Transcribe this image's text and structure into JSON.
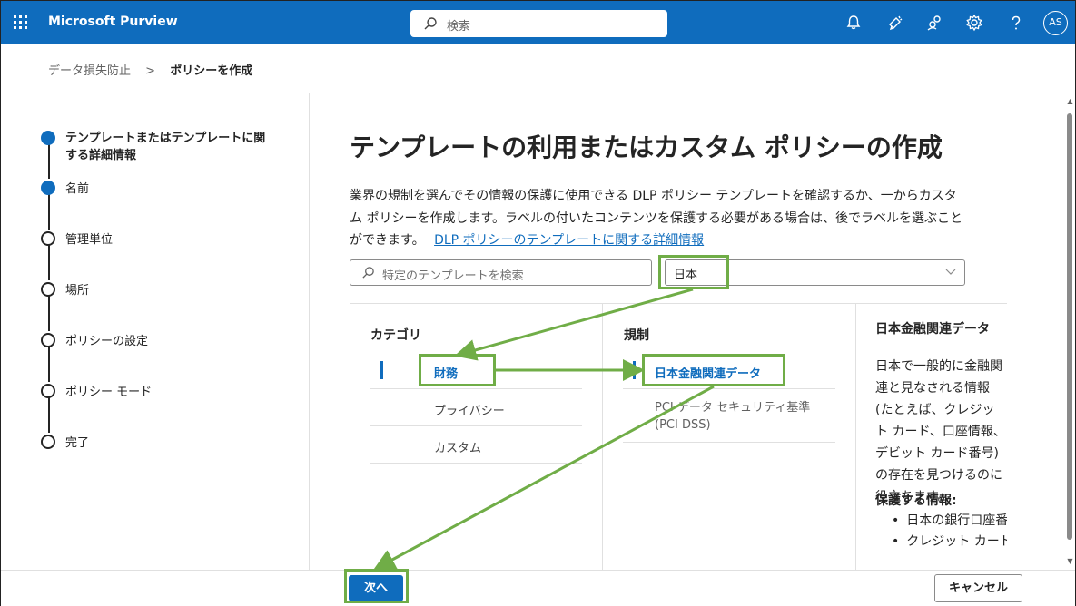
{
  "header": {
    "brand": "Microsoft Purview",
    "search_placeholder": "検索",
    "avatar_initials": "AS",
    "color": "#0f6cbd"
  },
  "breadcrumb": {
    "parent": "データ損失防止",
    "current": "ポリシーを作成"
  },
  "steps": [
    {
      "label": "テンプレートまたはテンプレートに関する詳細情報",
      "state": "done"
    },
    {
      "label": "名前",
      "state": "done"
    },
    {
      "label": "管理単位",
      "state": "todo"
    },
    {
      "label": "場所",
      "state": "todo"
    },
    {
      "label": "ポリシーの設定",
      "state": "todo"
    },
    {
      "label": "ポリシー モード",
      "state": "todo"
    },
    {
      "label": "完了",
      "state": "todo"
    }
  ],
  "main": {
    "title": "テンプレートの利用またはカスタム ポリシーの作成",
    "description_line1": "業界の規制を選んでその情報の保護に使用できる DLP ポリシー テンプレートを確認するか、一からカスタ",
    "description_line2": "ム ポリシーを作成します。ラベルの付いたコンテンツを保護する必要がある場合は、後でラベルを選ぶこと",
    "description_line3": "ができます。",
    "link": "DLP ポリシーのテンプレートに関する詳細情報",
    "template_search_placeholder": "特定のテンプレートを検索",
    "region_value": "日本"
  },
  "categories": {
    "header": "カテゴリ",
    "items": [
      "財務",
      "プライバシー",
      "カスタム"
    ]
  },
  "regulations": {
    "header": "規制",
    "items": [
      "日本金融関連データ",
      "PCI データ セキュリティ基準 (PCI DSS)"
    ]
  },
  "detail": {
    "title": "日本金融関連データ",
    "body": "日本で一般的に金融関連と見なされる情報 (たとえば、クレジット カード、口座情報、デビット カード番号) の存在を見つけるのに役立ちます。",
    "protects_label": "保護する情報:",
    "protects": [
      "日本の銀行口座番号",
      "クレジット カード番号"
    ]
  },
  "footer": {
    "next": "次へ",
    "cancel": "キャンセル"
  },
  "annotation_color": "#70ad47"
}
